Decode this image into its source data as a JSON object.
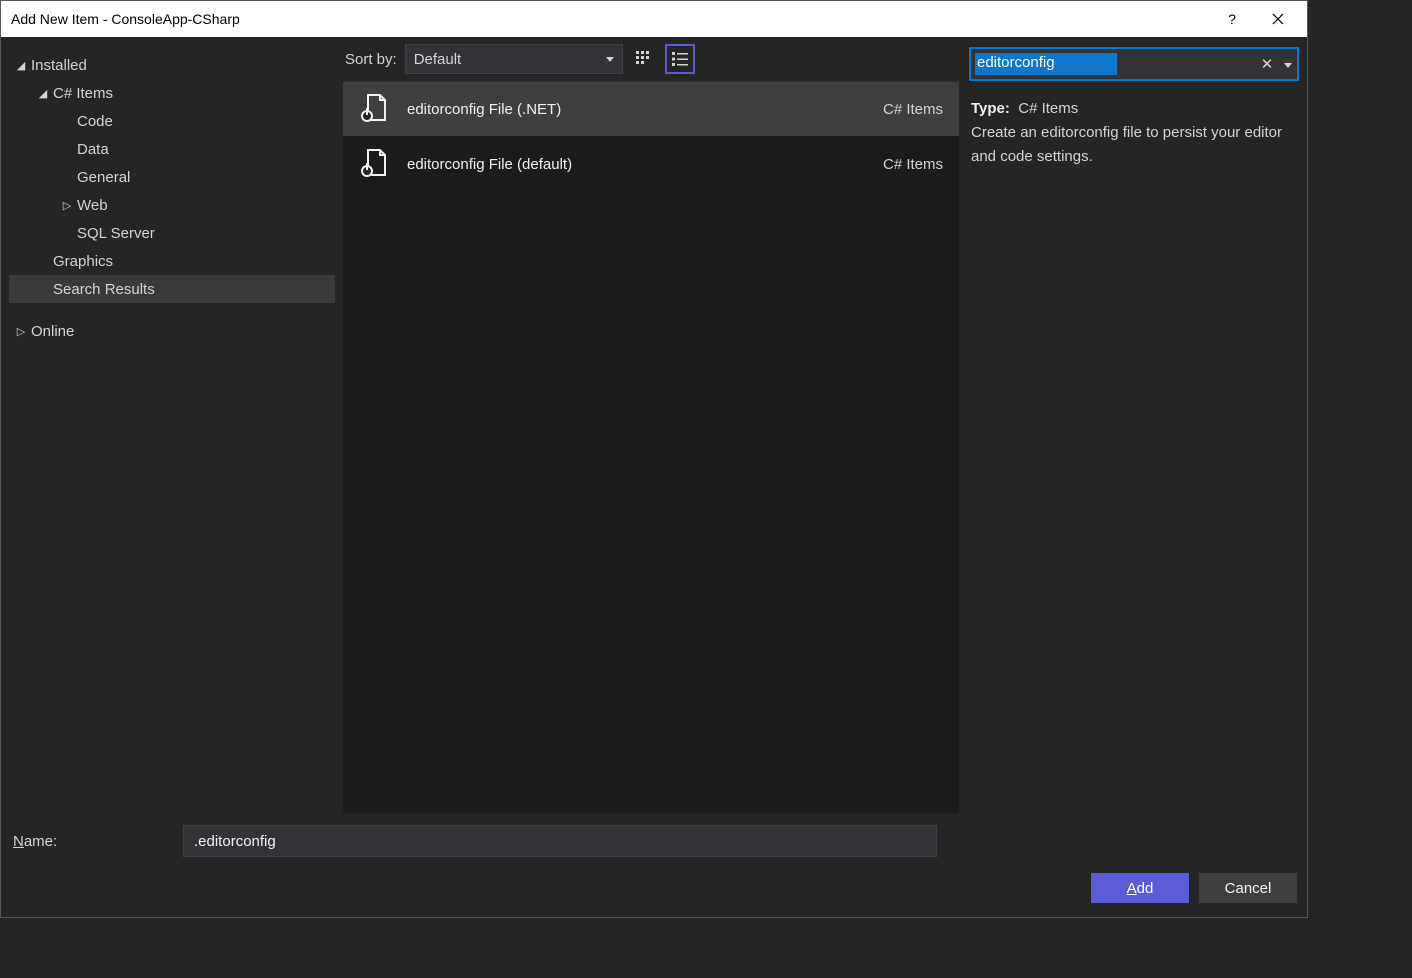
{
  "titlebar": {
    "title": "Add New Item - ConsoleApp-CSharp",
    "help": "?",
    "close": "✕"
  },
  "sidebar": {
    "installed": "Installed",
    "csharp": "C# Items",
    "code": "Code",
    "data": "Data",
    "general": "General",
    "web": "Web",
    "sqlserver": "SQL Server",
    "graphics": "Graphics",
    "searchresults": "Search Results",
    "online": "Online"
  },
  "toolbar": {
    "sort_label": "Sort by:",
    "sort_value": "Default"
  },
  "templates": [
    {
      "name": "editorconfig File (.NET)",
      "category": "C# Items",
      "selected": true
    },
    {
      "name": "editorconfig File (default)",
      "category": "C# Items",
      "selected": false
    }
  ],
  "search": {
    "value": "editorconfig"
  },
  "details": {
    "type_label": "Type:",
    "type_value": "C# Items",
    "description": "Create an editorconfig file to persist your editor and code settings."
  },
  "footer": {
    "name_label": "Name:",
    "name_value": ".editorconfig",
    "add": "Add",
    "cancel": "Cancel"
  }
}
